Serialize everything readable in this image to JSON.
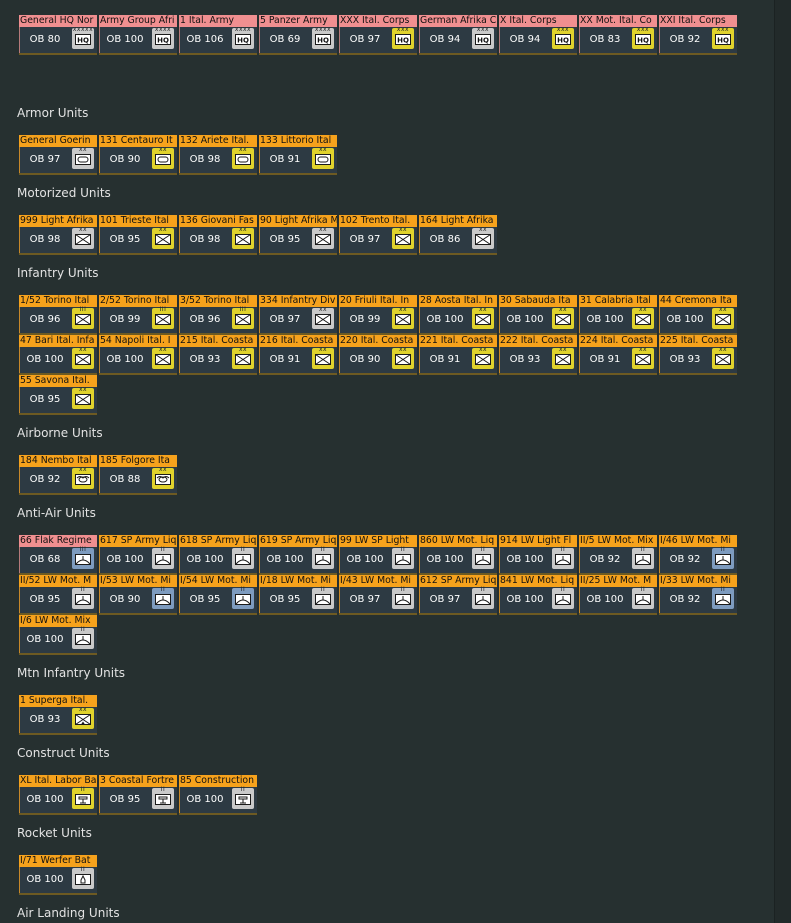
{
  "sections": [
    {
      "title": "",
      "rows": [
        [
          {
            "name": "General HQ Nor",
            "ob": "OB 80",
            "symbol": "hq",
            "pips": "xxxxx",
            "badge": "gray",
            "header": "pink"
          },
          {
            "name": "Army Group Afri",
            "ob": "OB 100",
            "symbol": "hq",
            "pips": "xxxx",
            "badge": "gray",
            "header": "pink"
          },
          {
            "name": "1 Ital. Army",
            "ob": "OB 106",
            "symbol": "hq",
            "pips": "xxxx",
            "badge": "gray",
            "header": "pink"
          },
          {
            "name": "5 Panzer Army",
            "ob": "OB 69",
            "symbol": "hq",
            "pips": "xxxx",
            "badge": "gray",
            "header": "pink"
          },
          {
            "name": "XXX Ital. Corps",
            "ob": "OB 97",
            "symbol": "hq",
            "pips": "xxx",
            "badge": "yellow",
            "header": "pink"
          },
          {
            "name": "German Afrika C",
            "ob": "OB 94",
            "symbol": "hq",
            "pips": "xxx",
            "badge": "gray",
            "header": "pink"
          },
          {
            "name": "X Ital. Corps",
            "ob": "OB 94",
            "symbol": "hq",
            "pips": "xxx",
            "badge": "yellow",
            "header": "pink"
          },
          {
            "name": "XX Mot. Ital. Co",
            "ob": "OB 83",
            "symbol": "hq",
            "pips": "xxx",
            "badge": "yellow",
            "header": "pink"
          },
          {
            "name": "XXI Ital. Corps",
            "ob": "OB 92",
            "symbol": "hq",
            "pips": "xxx",
            "badge": "yellow",
            "header": "pink"
          }
        ]
      ]
    },
    {
      "title": "Armor Units",
      "rows": [
        [
          {
            "name": "General Goerin",
            "ob": "OB 97",
            "symbol": "armor",
            "pips": "xx",
            "badge": "gray",
            "header": "orange"
          },
          {
            "name": "131 Centauro It",
            "ob": "OB 90",
            "symbol": "armor",
            "pips": "xx",
            "badge": "yellow",
            "header": "orange"
          },
          {
            "name": "132 Ariete Ital.",
            "ob": "OB 98",
            "symbol": "armor",
            "pips": "xx",
            "badge": "yellow",
            "header": "orange"
          },
          {
            "name": "133 Littorio Ital",
            "ob": "OB 91",
            "symbol": "armor",
            "pips": "xx",
            "badge": "yellow",
            "header": "orange"
          }
        ]
      ]
    },
    {
      "title": "Motorized Units",
      "rows": [
        [
          {
            "name": "999 Light Afrika",
            "ob": "OB 98",
            "symbol": "inf",
            "pips": "xx",
            "badge": "gray",
            "header": "orange"
          },
          {
            "name": "101 Trieste Ital",
            "ob": "OB 95",
            "symbol": "inf",
            "pips": "xx",
            "badge": "yellow",
            "header": "orange"
          },
          {
            "name": "136 Giovani Fas",
            "ob": "OB 98",
            "symbol": "inf",
            "pips": "xx",
            "badge": "yellow",
            "header": "orange"
          },
          {
            "name": "90 Light Afrika M",
            "ob": "OB 95",
            "symbol": "inf",
            "pips": "xx",
            "badge": "gray",
            "header": "orange"
          },
          {
            "name": "102 Trento Ital.",
            "ob": "OB 97",
            "symbol": "inf",
            "pips": "xx",
            "badge": "yellow",
            "header": "orange"
          },
          {
            "name": "164 Light Afrika",
            "ob": "OB 86",
            "symbol": "inf",
            "pips": "xx",
            "badge": "gray",
            "header": "orange"
          }
        ]
      ]
    },
    {
      "title": "Infantry Units",
      "rows": [
        [
          {
            "name": "1/52 Torino Ital",
            "ob": "OB 96",
            "symbol": "inf",
            "pips": "III",
            "badge": "yellow",
            "header": "orange"
          },
          {
            "name": "2/52 Torino Ital",
            "ob": "OB 99",
            "symbol": "inf",
            "pips": "III",
            "badge": "yellow",
            "header": "orange"
          },
          {
            "name": "3/52 Torino Ital",
            "ob": "OB 96",
            "symbol": "inf",
            "pips": "III",
            "badge": "yellow",
            "header": "orange"
          },
          {
            "name": "334 Infantry Div",
            "ob": "OB 97",
            "symbol": "inf",
            "pips": "xx",
            "badge": "gray",
            "header": "orange"
          },
          {
            "name": "20 Friuli Ital. In",
            "ob": "OB 99",
            "symbol": "inf",
            "pips": "xx",
            "badge": "yellow",
            "header": "orange"
          },
          {
            "name": "28 Aosta Ital. In",
            "ob": "OB 100",
            "symbol": "inf",
            "pips": "xx",
            "badge": "yellow",
            "header": "orange"
          },
          {
            "name": "30 Sabauda Ita",
            "ob": "OB 100",
            "symbol": "inf",
            "pips": "xx",
            "badge": "yellow",
            "header": "orange"
          },
          {
            "name": "31 Calabria Ital",
            "ob": "OB 100",
            "symbol": "inf",
            "pips": "xx",
            "badge": "yellow",
            "header": "orange"
          },
          {
            "name": "44 Cremona Ita",
            "ob": "OB 100",
            "symbol": "inf",
            "pips": "xx",
            "badge": "yellow",
            "header": "orange"
          }
        ],
        [
          {
            "name": "47 Bari Ital. Infa",
            "ob": "OB 100",
            "symbol": "inf",
            "pips": "xx",
            "badge": "yellow",
            "header": "orange"
          },
          {
            "name": "54 Napoli Ital. I",
            "ob": "OB 100",
            "symbol": "inf",
            "pips": "xx",
            "badge": "yellow",
            "header": "orange"
          },
          {
            "name": "215 Ital. Coasta",
            "ob": "OB 93",
            "symbol": "inf",
            "pips": "xx",
            "badge": "yellow",
            "header": "orange"
          },
          {
            "name": "216 Ital. Coasta",
            "ob": "OB 91",
            "symbol": "inf",
            "pips": "xx",
            "badge": "yellow",
            "header": "orange"
          },
          {
            "name": "220 Ital. Coasta",
            "ob": "OB 90",
            "symbol": "inf",
            "pips": "xx",
            "badge": "yellow",
            "header": "orange"
          },
          {
            "name": "221 Ital. Coasta",
            "ob": "OB 91",
            "symbol": "inf",
            "pips": "xx",
            "badge": "yellow",
            "header": "orange"
          },
          {
            "name": "222 Ital. Coasta",
            "ob": "OB 93",
            "symbol": "inf",
            "pips": "xx",
            "badge": "yellow",
            "header": "orange"
          },
          {
            "name": "224 Ital. Coasta",
            "ob": "OB 91",
            "symbol": "inf",
            "pips": "xx",
            "badge": "yellow",
            "header": "orange"
          },
          {
            "name": "225 Ital. Coasta",
            "ob": "OB 93",
            "symbol": "inf",
            "pips": "xx",
            "badge": "yellow",
            "header": "orange"
          }
        ],
        [
          {
            "name": "55 Savona Ital.",
            "ob": "OB 95",
            "symbol": "inf",
            "pips": "xx",
            "badge": "yellow",
            "header": "orange"
          }
        ]
      ]
    },
    {
      "title": "Airborne Units",
      "rows": [
        [
          {
            "name": "184 Nembo Ital",
            "ob": "OB 92",
            "symbol": "air",
            "pips": "xx",
            "badge": "yellow",
            "header": "orange"
          },
          {
            "name": "185 Folgore Ita",
            "ob": "OB 88",
            "symbol": "air",
            "pips": "xx",
            "badge": "yellow",
            "header": "orange"
          }
        ]
      ]
    },
    {
      "title": "Anti-Air Units",
      "rows": [
        [
          {
            "name": "66 Flak Regime",
            "ob": "OB 68",
            "symbol": "aa",
            "pips": "III",
            "badge": "blue",
            "header": "pink"
          },
          {
            "name": "617 SP Army Liq",
            "ob": "OB 100",
            "symbol": "aa",
            "pips": "II",
            "badge": "gray",
            "header": "orange"
          },
          {
            "name": "618 SP Army Liq",
            "ob": "OB 100",
            "symbol": "aa",
            "pips": "II",
            "badge": "gray",
            "header": "orange"
          },
          {
            "name": "619 SP Army Liq",
            "ob": "OB 100",
            "symbol": "aa",
            "pips": "II",
            "badge": "gray",
            "header": "orange"
          },
          {
            "name": "99 LW SP Light",
            "ob": "OB 100",
            "symbol": "aa",
            "pips": "II",
            "badge": "gray",
            "header": "orange"
          },
          {
            "name": "860 LW Mot. Liq",
            "ob": "OB 100",
            "symbol": "aa",
            "pips": "II",
            "badge": "gray",
            "header": "orange"
          },
          {
            "name": "914 LW Light Fl",
            "ob": "OB 100",
            "symbol": "aa",
            "pips": "II",
            "badge": "gray",
            "header": "orange"
          },
          {
            "name": "II/5 LW Mot. Mix",
            "ob": "OB 92",
            "symbol": "aa",
            "pips": "II",
            "badge": "gray",
            "header": "orange"
          },
          {
            "name": "I/46 LW Mot. Mi",
            "ob": "OB 92",
            "symbol": "aa",
            "pips": "II",
            "badge": "blue",
            "header": "orange"
          }
        ],
        [
          {
            "name": "II/52 LW Mot. M",
            "ob": "OB 95",
            "symbol": "aa",
            "pips": "II",
            "badge": "gray",
            "header": "orange"
          },
          {
            "name": "I/53 LW Mot. Mi",
            "ob": "OB 90",
            "symbol": "aa",
            "pips": "II",
            "badge": "blue",
            "header": "orange"
          },
          {
            "name": "I/54 LW Mot. Mi",
            "ob": "OB 95",
            "symbol": "aa",
            "pips": "II",
            "badge": "blue",
            "header": "orange"
          },
          {
            "name": "I/18 LW Mot. Mi",
            "ob": "OB 95",
            "symbol": "aa",
            "pips": "II",
            "badge": "gray",
            "header": "orange"
          },
          {
            "name": "I/43 LW Mot. Mi",
            "ob": "OB 97",
            "symbol": "aa",
            "pips": "II",
            "badge": "gray",
            "header": "orange"
          },
          {
            "name": "612 SP Army Liq",
            "ob": "OB 97",
            "symbol": "aa",
            "pips": "II",
            "badge": "gray",
            "header": "orange"
          },
          {
            "name": "841 LW Mot. Liq",
            "ob": "OB 100",
            "symbol": "aa",
            "pips": "II",
            "badge": "gray",
            "header": "orange"
          },
          {
            "name": "II/25 LW Mot. M",
            "ob": "OB 100",
            "symbol": "aa",
            "pips": "II",
            "badge": "gray",
            "header": "orange"
          },
          {
            "name": "I/33 LW Mot. Mi",
            "ob": "OB 92",
            "symbol": "aa",
            "pips": "II",
            "badge": "blue",
            "header": "orange"
          }
        ],
        [
          {
            "name": "I/6 LW Mot. Mix",
            "ob": "OB 100",
            "symbol": "aa",
            "pips": "II",
            "badge": "gray",
            "header": "orange"
          }
        ]
      ]
    },
    {
      "title": "Mtn Infantry Units",
      "rows": [
        [
          {
            "name": "1 Superga Ital.",
            "ob": "OB 93",
            "symbol": "mtn",
            "pips": "xx",
            "badge": "yellow",
            "header": "orange"
          }
        ]
      ]
    },
    {
      "title": "Construct Units",
      "rows": [
        [
          {
            "name": "XL Ital. Labor Ba",
            "ob": "OB 100",
            "symbol": "const",
            "pips": "II",
            "badge": "yellow",
            "header": "orange"
          },
          {
            "name": "3 Coastal Fortre",
            "ob": "OB 95",
            "symbol": "const",
            "pips": "II",
            "badge": "gray",
            "header": "orange"
          },
          {
            "name": "85 Construction",
            "ob": "OB 100",
            "symbol": "const",
            "pips": "II",
            "badge": "gray",
            "header": "orange"
          }
        ]
      ]
    },
    {
      "title": "Rocket Units",
      "rows": [
        [
          {
            "name": "I/71 Werfer Bat",
            "ob": "OB 100",
            "symbol": "rocket",
            "pips": "II",
            "badge": "gray",
            "header": "orange"
          }
        ]
      ]
    },
    {
      "title": "Air Landing Units",
      "rows": []
    }
  ]
}
